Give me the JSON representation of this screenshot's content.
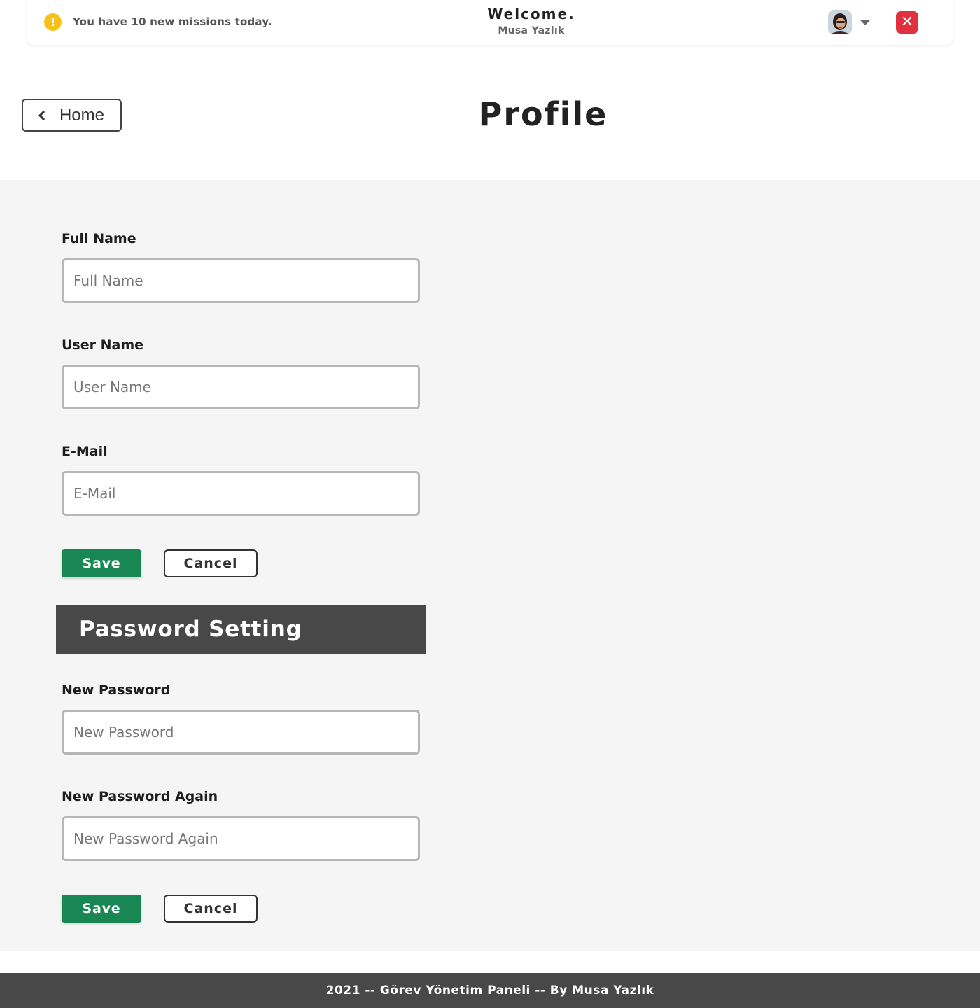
{
  "topbar": {
    "alert_text": "You have 10 new missions today.",
    "welcome_title": "Welcome.",
    "welcome_name": "Musa Yazlık",
    "alert_color": "#f6c21a",
    "close_color": "#e0313f"
  },
  "header": {
    "home_label": "Home",
    "title": "Profile"
  },
  "profile_form": {
    "full_name": {
      "label": "Full Name",
      "placeholder": "Full Name",
      "value": ""
    },
    "user_name": {
      "label": "User Name",
      "placeholder": "User Name",
      "value": ""
    },
    "email": {
      "label": "E-Mail",
      "placeholder": "E-Mail",
      "value": ""
    },
    "save_label": "Save",
    "cancel_label": "Cancel"
  },
  "password_form": {
    "heading": "Password Setting",
    "new_password": {
      "label": "New Password",
      "placeholder": "New Password",
      "value": ""
    },
    "new_password_again": {
      "label": "New Password Again",
      "placeholder": "New Password Again",
      "value": ""
    },
    "save_label": "Save",
    "cancel_label": "Cancel"
  },
  "footer": {
    "text": "2021 -- Görev Yönetim Paneli -- By Musa Yazlık"
  },
  "colors": {
    "save_button": "#198754",
    "section_header": "#484848",
    "panel_background": "#f5f5f5"
  }
}
